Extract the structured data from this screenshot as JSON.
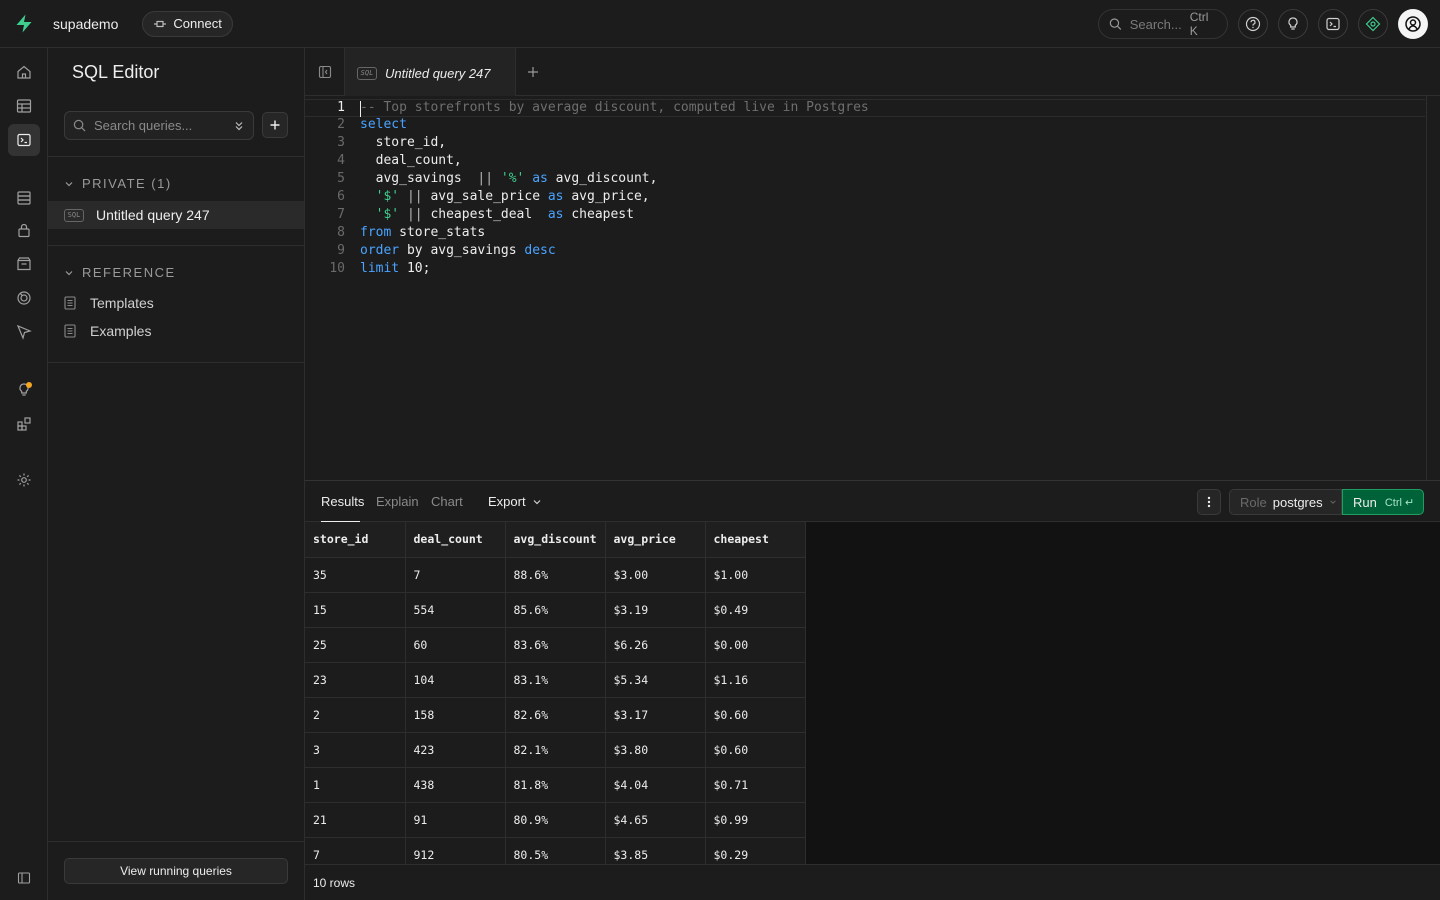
{
  "topbar": {
    "project": "supademo",
    "connect_label": "Connect",
    "search_placeholder": "Search...",
    "search_shortcut": "Ctrl K"
  },
  "sidebar": {
    "title": "SQL Editor",
    "search_placeholder": "Search queries...",
    "private_label": "PRIVATE (1)",
    "queries": [
      {
        "badge": "SQL",
        "name": "Untitled query 247"
      }
    ],
    "reference_label": "REFERENCE",
    "reference_items": [
      "Templates",
      "Examples"
    ],
    "view_running_label": "View running queries"
  },
  "tab": {
    "badge": "SQL",
    "title": "Untitled query 247"
  },
  "editor": {
    "line_numbers": [
      "1",
      "2",
      "3",
      "4",
      "5",
      "6",
      "7",
      "8",
      "9",
      "10"
    ]
  },
  "results": {
    "tabs": [
      "Results",
      "Explain",
      "Chart"
    ],
    "export_label": "Export",
    "role_label": "Role",
    "role_value": "postgres",
    "run_label": "Run",
    "run_shortcut": "Ctrl ↵",
    "columns": [
      "store_id",
      "deal_count",
      "avg_discount",
      "avg_price",
      "cheapest"
    ],
    "rows": [
      [
        "35",
        "7",
        "88.6%",
        "$3.00",
        "$1.00"
      ],
      [
        "15",
        "554",
        "85.6%",
        "$3.19",
        "$0.49"
      ],
      [
        "25",
        "60",
        "83.6%",
        "$6.26",
        "$0.00"
      ],
      [
        "23",
        "104",
        "83.1%",
        "$5.34",
        "$1.16"
      ],
      [
        "2",
        "158",
        "82.6%",
        "$3.17",
        "$0.60"
      ],
      [
        "3",
        "423",
        "82.1%",
        "$3.80",
        "$0.60"
      ],
      [
        "1",
        "438",
        "81.8%",
        "$4.04",
        "$0.71"
      ],
      [
        "21",
        "91",
        "80.9%",
        "$4.65",
        "$0.99"
      ],
      [
        "7",
        "912",
        "80.5%",
        "$3.85",
        "$0.29"
      ]
    ],
    "row_count": "10 rows"
  },
  "colors": {
    "accent": "#3ecf8e",
    "run_bg": "#006239",
    "keyword": "#4aa3ff",
    "notification_dot": "#f5a623"
  }
}
